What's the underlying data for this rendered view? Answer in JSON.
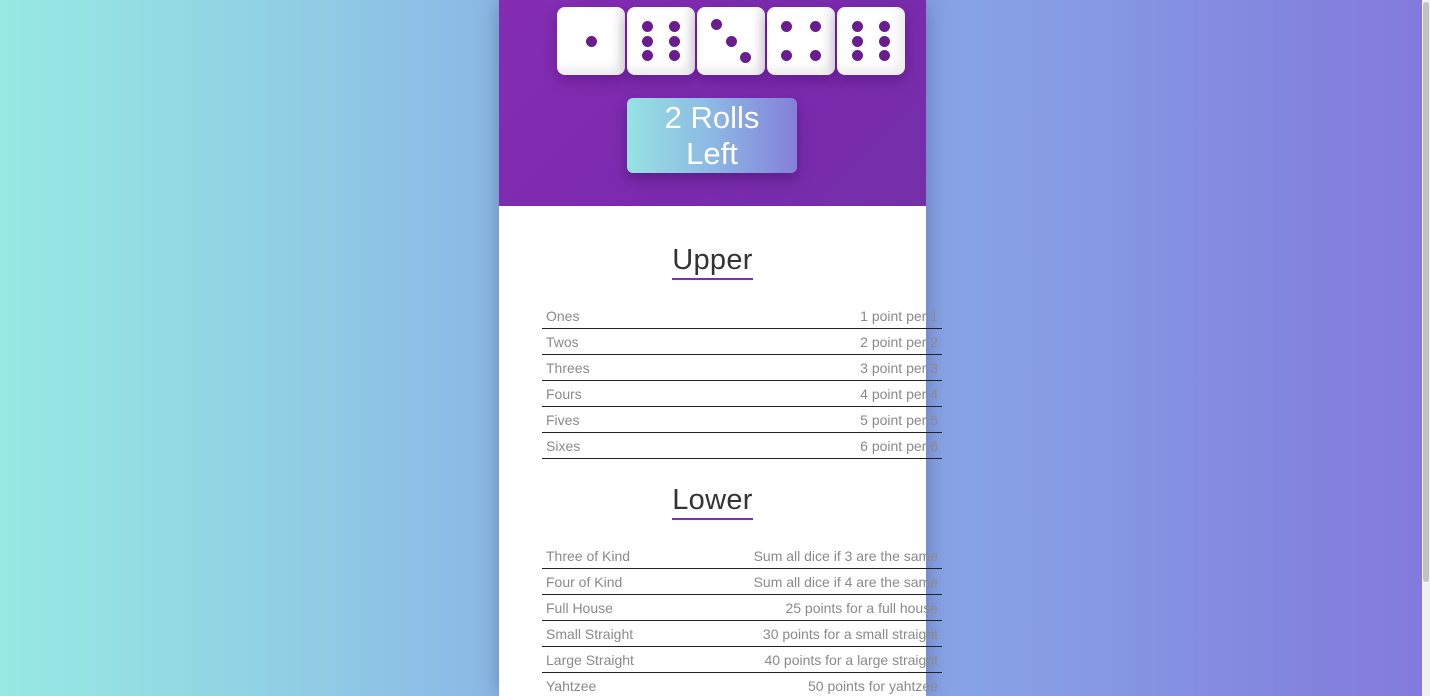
{
  "dice": [
    {
      "value": 1,
      "icon": "die-face-1-icon"
    },
    {
      "value": 6,
      "icon": "die-face-6-icon"
    },
    {
      "value": 3,
      "icon": "die-face-3-icon"
    },
    {
      "value": 4,
      "icon": "die-face-4-icon"
    },
    {
      "value": 6,
      "icon": "die-face-6-icon"
    }
  ],
  "roll_button": {
    "label": "2 Rolls Left"
  },
  "upper": {
    "title": "Upper",
    "rows": [
      {
        "name": "Ones",
        "description": "1 point per 1"
      },
      {
        "name": "Twos",
        "description": "2 point per 2"
      },
      {
        "name": "Threes",
        "description": "3 point per 3"
      },
      {
        "name": "Fours",
        "description": "4 point per 4"
      },
      {
        "name": "Fives",
        "description": "5 point per 5"
      },
      {
        "name": "Sixes",
        "description": "6 point per 6"
      }
    ]
  },
  "lower": {
    "title": "Lower",
    "rows": [
      {
        "name": "Three of Kind",
        "description": "Sum all dice if 3 are the same"
      },
      {
        "name": "Four of Kind",
        "description": "Sum all dice if 4 are the same"
      },
      {
        "name": "Full House",
        "description": "25 points for a full house"
      },
      {
        "name": "Small Straight",
        "description": "30 points for a small straight"
      },
      {
        "name": "Large Straight",
        "description": "40 points for a large straight"
      },
      {
        "name": "Yahtzee",
        "description": "50 points for yahtzee"
      }
    ]
  },
  "colors": {
    "header_purple": "#842db2",
    "pip_purple": "#6a1d8e",
    "gradient_start": "#97e9e3",
    "gradient_end": "#8479dc"
  }
}
